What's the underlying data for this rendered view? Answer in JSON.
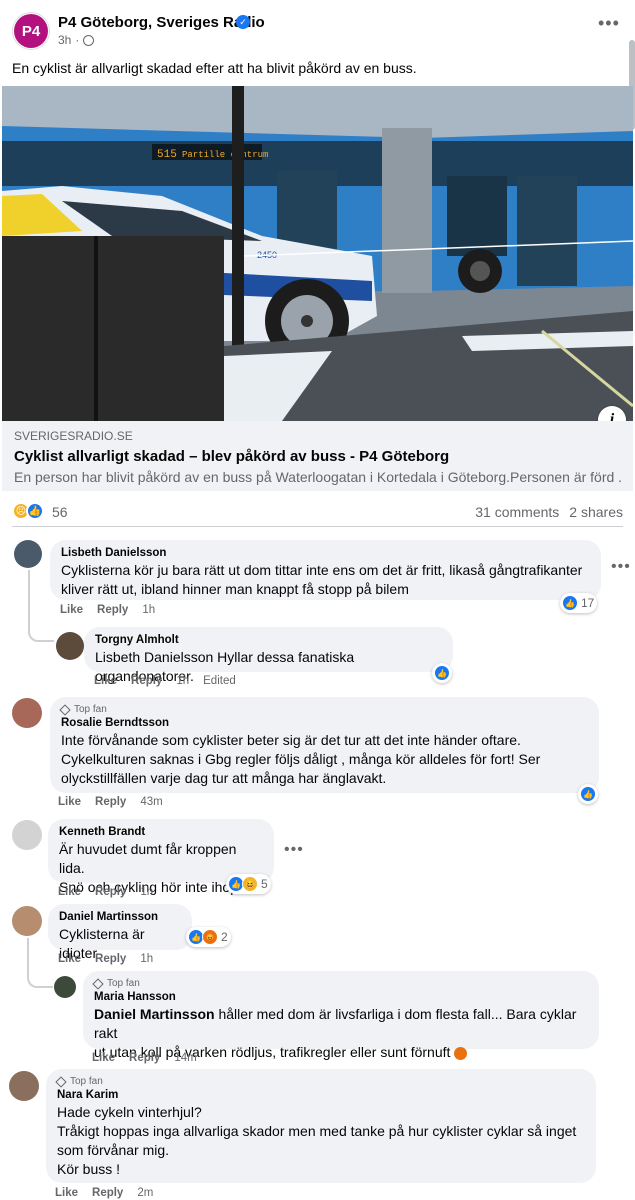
{
  "post": {
    "page_name": "P4 Göteborg, Sveriges Radio",
    "avatar_text": "P4",
    "time": "3h",
    "text": "En cyklist är allvarligt skadad efter att ha blivit påkörd av en buss."
  },
  "link": {
    "domain": "SVERIGESRADIO.SE",
    "title": "Cyklist allvarligt skadad – blev påkörd av buss - P4 Göteborg",
    "description": "En person har blivit påkörd av en buss på Waterloogatan i Kortedala i Göteborg.Personen är förd ...",
    "image_text": {
      "bus_line": "515",
      "bus_dest": "Partille centrum",
      "police_plate": "2450"
    },
    "info_label": "i"
  },
  "stats": {
    "reaction_count": "56",
    "comments": "31 comments",
    "shares": "2 shares"
  },
  "actions": {
    "like": "Like",
    "reply": "Reply",
    "edited": "Edited"
  },
  "top_fan_label": "Top fan",
  "comments": [
    {
      "author": "Lisbeth Danielsson",
      "lines": [
        "Cyklisterna kör ju bara rätt ut dom tittar inte ens om det är fritt, likaså gångtrafikanter",
        "kliver rätt ut, ibland hinner man knappt få stopp på bilem"
      ],
      "time": "1h",
      "reactions": "17"
    },
    {
      "author": "Torgny Almholt",
      "mention": "Lisbeth Danielsson",
      "text": " Hyllar dessa fanatiska organdonatorer.",
      "time": "1h"
    },
    {
      "author": "Rosalie Berndtsson",
      "lines": [
        "Inte förvånande som cyklister beter sig är det tur att det inte händer oftare.",
        "Cykelkulturen saknas i Gbg regler följs dåligt , många kör alldeles för fort! Ser",
        "olyckstillfällen varje dag tur att många har änglavakt."
      ],
      "time": "43m"
    },
    {
      "author": "Kenneth Brandt",
      "lines": [
        "Är huvudet dumt får kroppen lida.",
        "Snö och cykling hör inte ihop."
      ],
      "time": "1h",
      "reactions": "5"
    },
    {
      "author": "Daniel Martinsson",
      "lines": [
        "Cyklisterna är idioter"
      ],
      "time": "1h",
      "reactions": "2"
    },
    {
      "author": "Maria Hansson",
      "mention": "Daniel Martinsson",
      "lines": [
        " håller med dom är livsfarliga i dom flesta fall... Bara cyklar rakt",
        "ut utan koll på varken rödljus, trafikregler eller sunt förnuft"
      ],
      "time": "14m"
    },
    {
      "author": "Nara Karim",
      "lines": [
        "Hade cykeln vinterhjul?",
        "Tråkigt hoppas inga allvarliga skador men med tanke på hur cyklister cyklar så inget",
        "som förvånar mig.",
        "Kör buss !"
      ],
      "time": "2m"
    }
  ]
}
